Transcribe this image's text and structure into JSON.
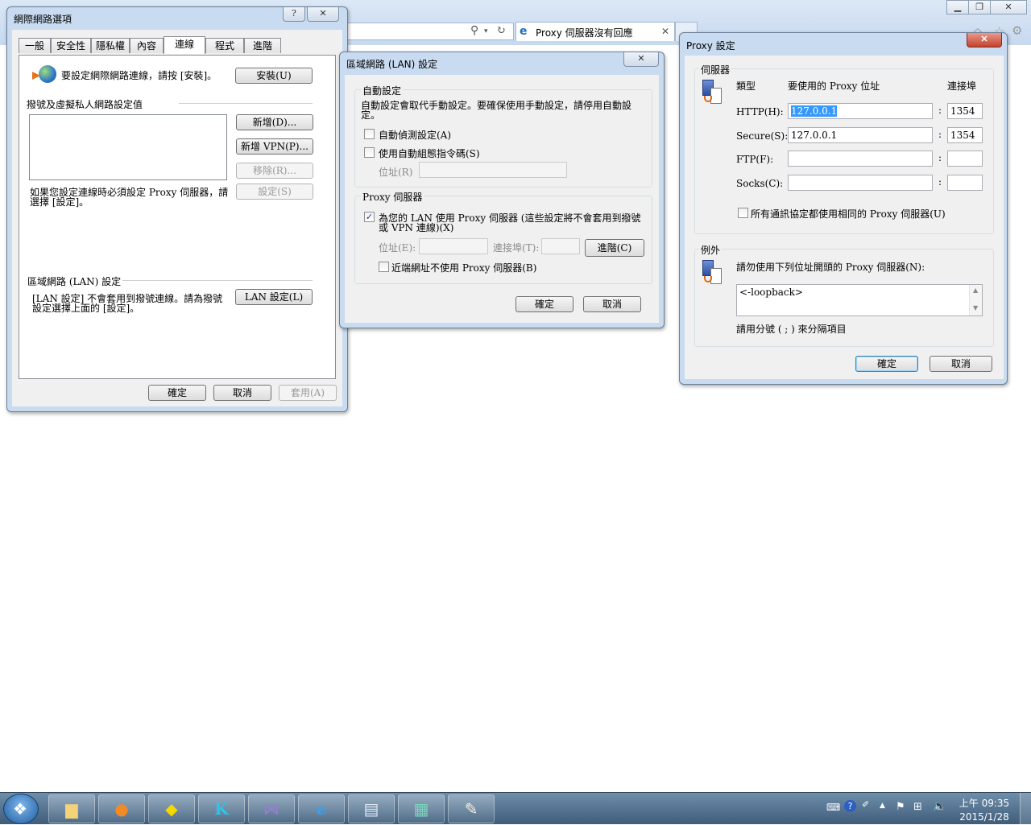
{
  "browser": {
    "tab_label": "Proxy 伺服器沒有回應"
  },
  "internet_options": {
    "title": "網際網路選項",
    "help_glyph": "?",
    "close_glyph": "✕",
    "tabs": [
      "一般",
      "安全性",
      "隱私權",
      "內容",
      "連線",
      "程式",
      "進階"
    ],
    "setup_text": "要設定網際網路連線，請按 [安裝]。",
    "setup_button": "安裝(U)",
    "dialup_heading": "撥號及虛擬私人網路設定值",
    "add_button": "新增(D)...",
    "add_vpn_button": "新增 VPN(P)...",
    "remove_button": "移除(R)...",
    "settings_button": "設定(S)",
    "proxy_note_line1": "如果您設定連線時必須設定 Proxy 伺服器，請",
    "proxy_note_line2": "選擇 [設定]。",
    "lan_heading": "區域網路 (LAN) 設定",
    "lan_note_line1": "[LAN 設定] 不會套用到撥號連線。請為撥號",
    "lan_note_line2": "設定選擇上面的 [設定]。",
    "lan_button": "LAN 設定(L)",
    "ok": "確定",
    "cancel": "取消",
    "apply": "套用(A)"
  },
  "lan_settings": {
    "title": "區域網路 (LAN) 設定",
    "close_glyph": "✕",
    "auto_group": "自動設定",
    "auto_desc_line1": "自動設定會取代手動設定。要確保使用手動設定，請停用自動設",
    "auto_desc_line2": "定。",
    "auto_detect": "自動偵測設定(A)",
    "auto_script": "使用自動組態指令碼(S)",
    "address_label": "位址(R)",
    "proxy_group": "Proxy 伺服器",
    "use_proxy_line1": "為您的 LAN 使用 Proxy 伺服器 (這些設定將不會套用到撥號",
    "use_proxy_line2": "或 VPN 連線)(X)",
    "use_proxy_checked": "✓",
    "addr_label": "位址(E):",
    "port_label": "連接埠(T):",
    "advanced_button": "進階(C)",
    "bypass_local": "近端網址不使用 Proxy 伺服器(B)",
    "ok": "確定",
    "cancel": "取消"
  },
  "proxy_settings": {
    "title": "Proxy 設定",
    "close_glyph": "✕",
    "servers_group": "伺服器",
    "col_type": "類型",
    "col_address": "要使用的 Proxy 位址",
    "col_port": "連接埠",
    "colon": ":",
    "rows": [
      {
        "label": "HTTP(H):",
        "address": "127.0.0.1",
        "port": "1354"
      },
      {
        "label": "Secure(S):",
        "address": "127.0.0.1",
        "port": "1354"
      },
      {
        "label": "FTP(F):",
        "address": "",
        "port": ""
      },
      {
        "label": "Socks(C):",
        "address": "",
        "port": ""
      }
    ],
    "same_for_all": "所有通訊協定都使用相同的 Proxy 伺服器(U)",
    "exceptions_group": "例外",
    "exceptions_label": "請勿使用下列位址開頭的 Proxy 伺服器(N):",
    "exceptions_value": "<-loopback>",
    "exceptions_hint": "請用分號 ( ; ) 來分隔項目",
    "ok": "確定",
    "cancel": "取消"
  },
  "taskbar": {
    "time": "上午 09:35",
    "date": "2015/1/28"
  }
}
